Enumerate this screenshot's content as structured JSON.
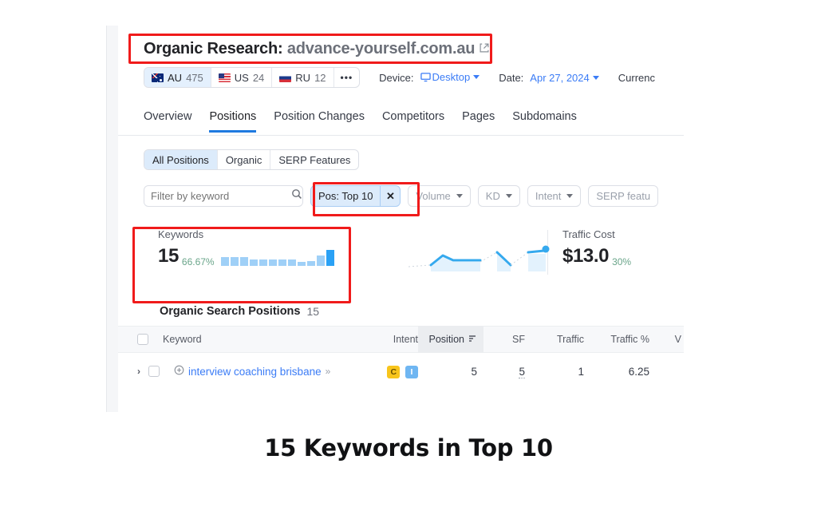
{
  "header": {
    "title_prefix": "Organic Research:",
    "domain": "advance-yourself.com.au",
    "external_link_icon": "external-link-icon"
  },
  "databases": [
    {
      "code": "AU",
      "count": "475",
      "flag": "flag-au",
      "active": true
    },
    {
      "code": "US",
      "count": "24",
      "flag": "flag-us",
      "active": false
    },
    {
      "code": "RU",
      "count": "12",
      "flag": "flag-ru",
      "active": false
    }
  ],
  "more_label": "•••",
  "device": {
    "label": "Device:",
    "value": "Desktop",
    "icon": "monitor-icon"
  },
  "date": {
    "label": "Date:",
    "value": "Apr 27, 2024"
  },
  "currency": {
    "label": "Currenc"
  },
  "tabs": [
    {
      "label": "Overview",
      "active": false
    },
    {
      "label": "Positions",
      "active": true
    },
    {
      "label": "Position Changes",
      "active": false
    },
    {
      "label": "Competitors",
      "active": false
    },
    {
      "label": "Pages",
      "active": false
    },
    {
      "label": "Subdomains",
      "active": false
    }
  ],
  "segments": [
    {
      "label": "All Positions",
      "active": true
    },
    {
      "label": "Organic",
      "active": false
    },
    {
      "label": "SERP Features",
      "active": false
    }
  ],
  "filters": {
    "keyword_placeholder": "Filter by keyword",
    "keyword_value": "",
    "search_icon": "search-icon",
    "position_chip": {
      "label": "Pos: Top 10",
      "close": "✕"
    },
    "dropdowns": [
      {
        "label": "Volume"
      },
      {
        "label": "KD"
      },
      {
        "label": "Intent"
      },
      {
        "label": "SERP featu"
      }
    ]
  },
  "cards": {
    "keywords": {
      "caption": "Keywords",
      "value": "15",
      "percent": "66.67%"
    },
    "traffic_cost": {
      "caption": "Traffic Cost",
      "value": "$13.0",
      "percent": "30%"
    }
  },
  "table": {
    "title": "Organic Search Positions",
    "count": "15",
    "columns": [
      {
        "label": "Keyword"
      },
      {
        "label": "Intent"
      },
      {
        "label": "Position",
        "sorted": true,
        "sort_icon": "sort-icon"
      },
      {
        "label": "SF"
      },
      {
        "label": "Traffic"
      },
      {
        "label": "Traffic %"
      },
      {
        "label": "V"
      }
    ],
    "rows": [
      {
        "expand": "›",
        "keyword": "interview coaching brisbane",
        "intent": [
          "C",
          "I"
        ],
        "position": "5",
        "sf": "5",
        "traffic": "1",
        "traffic_pct": "6.25",
        "volume": ""
      }
    ]
  },
  "chart_data": {
    "type": "bar",
    "title": "Keywords trend sparkline",
    "categories": [
      "1",
      "2",
      "3",
      "4",
      "5",
      "6",
      "7",
      "8",
      "9",
      "10",
      "11",
      "12"
    ],
    "values": [
      11,
      11,
      11,
      8,
      8,
      8,
      8,
      8,
      5,
      6,
      13,
      20
    ],
    "ylim": [
      0,
      22
    ],
    "xlabel": "",
    "ylabel": "",
    "grid": false,
    "legend": "none",
    "colors": {
      "bar": "#9fd0f7",
      "bar_last": "#2aa1f5"
    }
  },
  "colors": {
    "accent_blue": "#3b7cf6",
    "tab_underline": "#1f7ae0",
    "chip_bg": "#dcebfb",
    "annotation_red": "#f01b1b",
    "positive_green": "#6aa58a"
  },
  "caption": "15 Keywords in Top 10"
}
